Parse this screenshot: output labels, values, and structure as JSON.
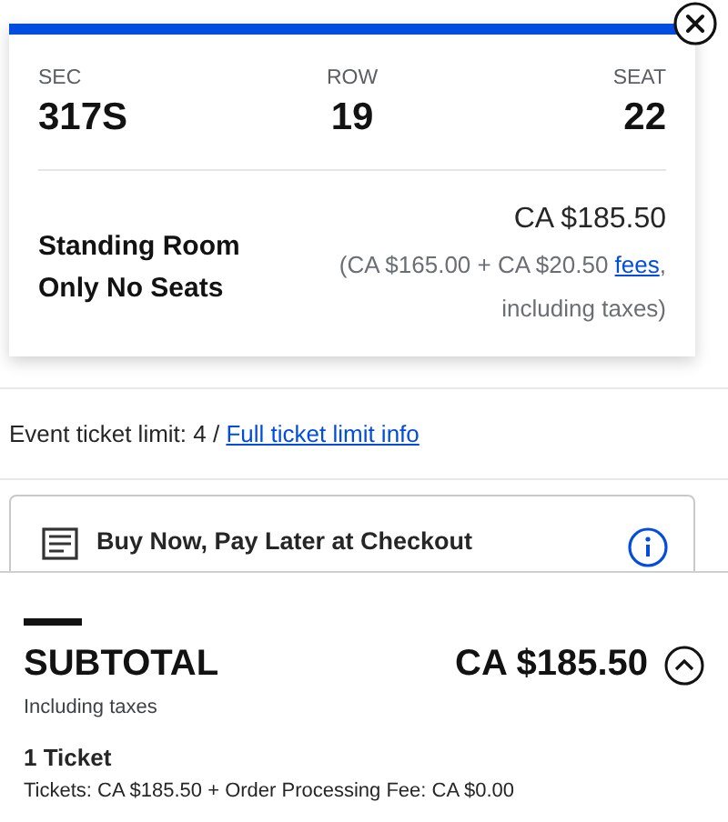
{
  "ticket": {
    "section_label": "SEC",
    "section": "317S",
    "row_label": "ROW",
    "row": "19",
    "seat_label": "SEAT",
    "seat": "22",
    "description": "Standing Room Only No Seats",
    "price": "CA $185.50",
    "breakdown": "(CA $165.00 + CA $20.50",
    "fees_link": "fees",
    "breakdown_end": ", including taxes)"
  },
  "ticket_limit": {
    "text": "Event ticket limit: 4 /",
    "link": "Full ticket limit info"
  },
  "payment_option": {
    "text": "Buy Now, Pay Later at Checkout"
  },
  "subtotal": {
    "label": "SUBTOTAL",
    "amount": "CA $185.50",
    "note": "Including taxes",
    "expanded": true,
    "count": "1 Ticket",
    "details": "Tickets: CA $185.50 + Order Processing Fee: CA $0.00"
  }
}
